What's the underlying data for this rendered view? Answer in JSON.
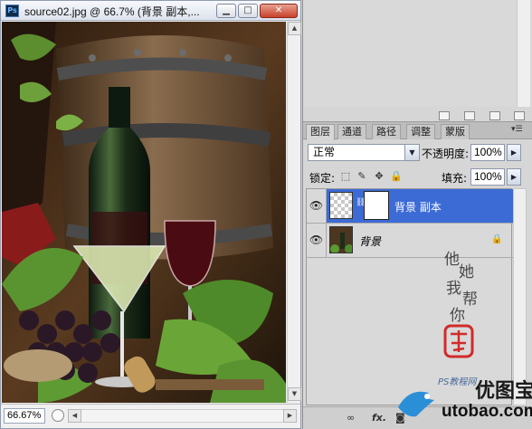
{
  "document": {
    "title": "source02.jpg @ 66.7% (背景 副本,...",
    "app_icon": "Ps",
    "zoom": "66.67%",
    "window_buttons": {
      "minimize": "▁",
      "maximize": "□",
      "close": "✕"
    }
  },
  "layers_panel": {
    "tabs": [
      "图层",
      "通道",
      "路径",
      "调整",
      "蒙版"
    ],
    "active_tab": "图层",
    "blend_mode": "正常",
    "opacity_label": "不透明度:",
    "opacity_value": "100%",
    "lock_label": "锁定:",
    "fill_label": "填充:",
    "fill_value": "100%",
    "layers": [
      {
        "name": "背景 副本",
        "selected": true,
        "visible": true,
        "has_mask": true
      },
      {
        "name": "背景",
        "selected": false,
        "visible": true,
        "locked": true
      }
    ],
    "bottom_icons": [
      "link-icon",
      "fx-icon",
      "mask-icon"
    ],
    "fx_label": "fx."
  },
  "watermark": {
    "site_name": "优图宝",
    "url": "utobao.com",
    "small_text": "PS教程网",
    "calligraphy": [
      "他",
      "她",
      "我",
      "帮",
      "你"
    ]
  },
  "colors": {
    "selection": "#3c6bd5",
    "panel_bg": "#d6d6d6",
    "close_button": "#c7412b"
  }
}
